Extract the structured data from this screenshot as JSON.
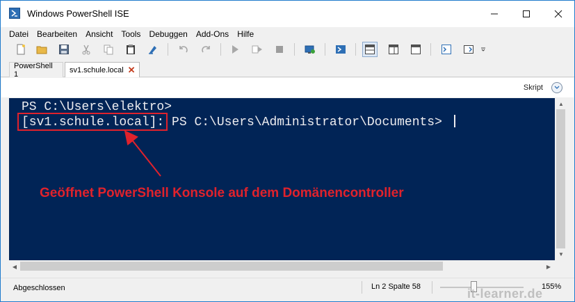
{
  "window": {
    "title": "Windows PowerShell ISE",
    "controls": {
      "minimize": "minimize-icon",
      "maximize": "maximize-icon",
      "close": "close-icon"
    }
  },
  "menu": {
    "items": [
      "Datei",
      "Bearbeiten",
      "Ansicht",
      "Tools",
      "Debuggen",
      "Add-Ons",
      "Hilfe"
    ]
  },
  "toolbar": {
    "buttons": [
      "new-file-icon",
      "open-folder-icon",
      "save-icon",
      "cut-icon",
      "copy-icon",
      "paste-icon",
      "clear-console-icon",
      "undo-icon",
      "redo-icon",
      "run-icon",
      "run-selection-icon",
      "stop-icon",
      "new-remote-tab-icon",
      "start-powershell-icon",
      "layout-top-icon",
      "layout-right-icon",
      "layout-max-icon",
      "show-commands-icon",
      "show-addon-icon"
    ]
  },
  "tabs": [
    {
      "label": "PowerShell 1",
      "active": false
    },
    {
      "label": "sv1.schule.local",
      "active": true
    }
  ],
  "script_pane": {
    "label": "Skript"
  },
  "console": {
    "line1": "PS C:\\Users\\elektro>",
    "session": "[sv1.schule.local]:",
    "prompt": " PS C:\\Users\\Administrator\\Documents> ",
    "background": "#012456",
    "text_color": "#eeedf0"
  },
  "annotation": {
    "text": "Geöffnet PowerShell Konsole auf dem Domänencontroller",
    "color": "#e0222c"
  },
  "status": {
    "state": "Abgeschlossen",
    "position": "Ln 2  Spalte 58",
    "zoom": "155%"
  },
  "watermark": "it-learner.de"
}
